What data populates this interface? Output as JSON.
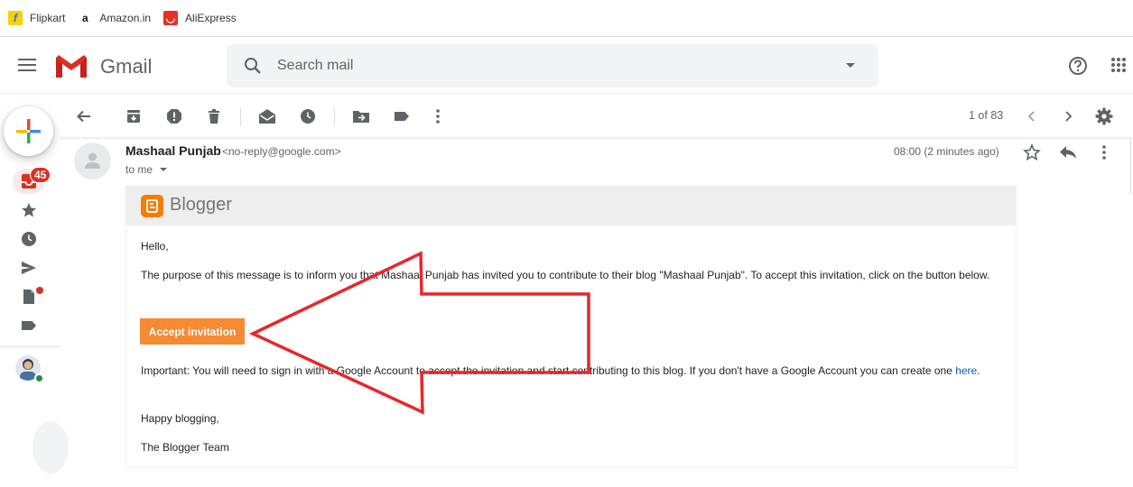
{
  "bookmarks": [
    {
      "label": "Flipkart",
      "icon": "flipkart-icon"
    },
    {
      "label": "Amazon.in",
      "icon": "amazon-icon"
    },
    {
      "label": "AliExpress",
      "icon": "aliexpress-icon"
    }
  ],
  "header": {
    "app_name": "Gmail",
    "search_placeholder": "Search mail"
  },
  "sidebar": {
    "inbox_badge": "45"
  },
  "toolbar": {
    "count": "1 of 83"
  },
  "message": {
    "sender_name": "Mashaal Punjab",
    "sender_email": "<no-reply@google.com>",
    "recipient": "to me",
    "timestamp": "08:00 (2 minutes ago)"
  },
  "email": {
    "brand": "Blogger",
    "greeting": "Hello,",
    "paragraph1": "The purpose of this message is to inform you that Mashaal Punjab has invited you to contribute to their blog \"Mashaal Punjab\". To accept this invitation, click on the button below.",
    "button_label": "Accept invitation",
    "important_text": "Important: You will need to sign in with a Google Account to accept the invitation and start contributing to this blog. If you don't have a Google Account you can create one ",
    "link_text": "here",
    "link_suffix": ".",
    "closing": "Happy blogging,",
    "signature": "The Blogger Team"
  },
  "colors": {
    "accent_red": "#d93025",
    "blogger_orange": "#f57d00",
    "button_orange": "#f58a32",
    "annotation_arrow": "#e8262b"
  }
}
